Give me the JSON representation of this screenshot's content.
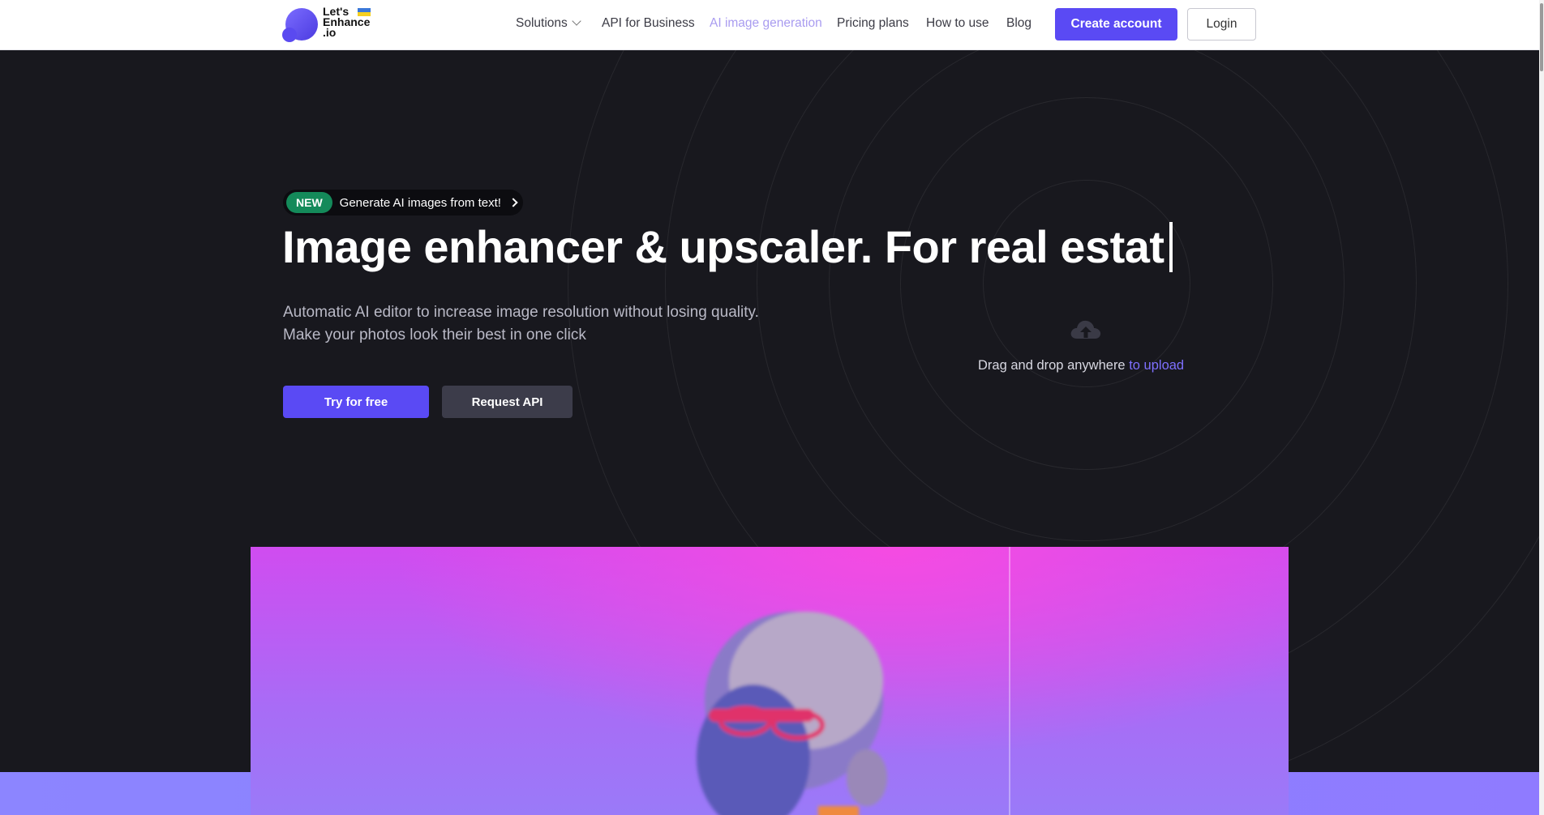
{
  "header": {
    "logo_text": [
      "Let's",
      "Enhance",
      ".io"
    ],
    "nav": [
      {
        "label": "Solutions",
        "has_dropdown": true
      },
      {
        "label": "API for Business"
      },
      {
        "label": "AI image generation",
        "active": true
      },
      {
        "label": "Pricing plans"
      },
      {
        "label": "How to use"
      },
      {
        "label": "Blog"
      }
    ],
    "create_account_label": "Create account",
    "login_label": "Login"
  },
  "hero": {
    "badge_new": "NEW",
    "badge_text": "Generate AI images from text!",
    "title": "Image enhancer & upscaler. For real estat",
    "subtitle_line1": "Automatic AI editor to increase image resolution without losing quality.",
    "subtitle_line2": "Make your photos look their best in one click",
    "try_label": "Try for free",
    "api_label": "Request API"
  },
  "upload": {
    "text": "Drag and drop anywhere ",
    "link": "to upload",
    "icon": "cloud-upload-icon"
  },
  "colors": {
    "accent": "#5a4af4",
    "background": "#18181e",
    "badge_green": "#148a5a",
    "link": "#7e70ff"
  }
}
